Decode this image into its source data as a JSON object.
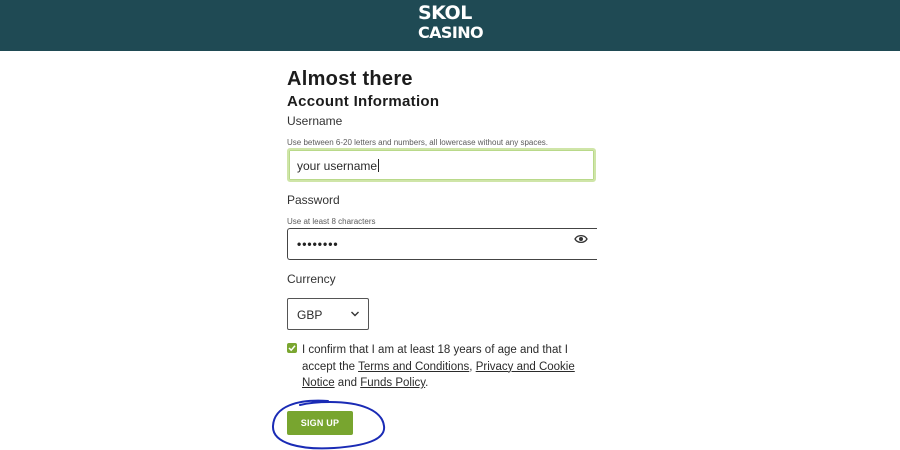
{
  "header": {
    "logo_line1": "SKOL",
    "logo_line2": "CASINO",
    "background_color": "#1f4a54"
  },
  "page": {
    "title": "Almost there",
    "subtitle": "Account Information"
  },
  "username": {
    "label": "Username",
    "hint": "Use between 6-20 letters and numbers, all lowercase without any spaces.",
    "value": "your username"
  },
  "password": {
    "label": "Password",
    "hint": "Use at least 8 characters",
    "masked_value": "••••••••",
    "toggle_icon": "eye-icon"
  },
  "currency": {
    "label": "Currency",
    "selected": "GBP",
    "icon": "chevron-down-icon"
  },
  "consent": {
    "checked": true,
    "text_1": "I confirm that I am at least 18 years of age and that I accept the ",
    "link_terms": "Terms and Conditions",
    "sep_1": ", ",
    "link_privacy": "Privacy and Cookie Notice",
    "sep_2": " and ",
    "link_funds": "Funds Policy",
    "end": "."
  },
  "actions": {
    "signup_label": "SIGN UP",
    "accent_color": "#78a52f"
  },
  "annotation": {
    "color": "#1a2bb5",
    "shape": "hand-drawn circle around sign up button"
  }
}
